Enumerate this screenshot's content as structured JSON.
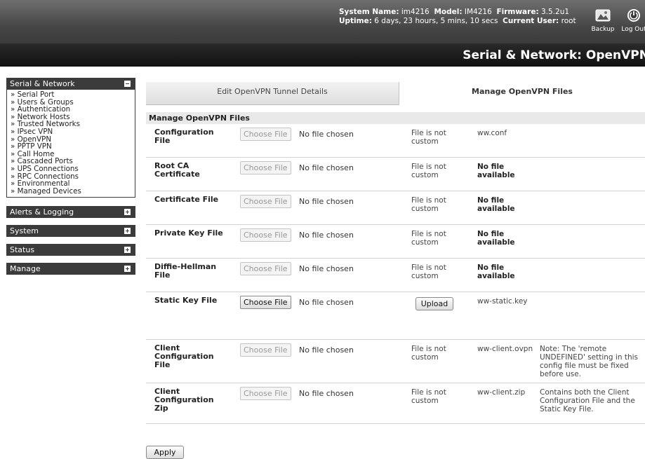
{
  "header": {
    "system_name_label": "System Name:",
    "system_name": "im4216",
    "model_label": "Model:",
    "model": "IM4216",
    "firmware_label": "Firmware:",
    "firmware": "3.5.2u1",
    "uptime_label": "Uptime:",
    "uptime": "6 days, 23 hours, 5 mins, 10 secs",
    "current_user_label": "Current User:",
    "current_user": "root",
    "backup_label": "Backup",
    "logout_label": "Log Out",
    "backup_icon": "backup-icon",
    "logout_icon": "power-icon"
  },
  "page_title": "Serial & Network: OpenVPN",
  "sidebar": {
    "sections": [
      {
        "label": "Serial & Network",
        "expanded": true,
        "items": [
          "» Serial Port",
          "» Users & Groups",
          "» Authentication",
          "» Network Hosts",
          "» Trusted Networks",
          "» IPsec VPN",
          "» OpenVPN",
          "» PPTP VPN",
          "» Call Home",
          "» Cascaded Ports",
          "» UPS Connections",
          "» RPC Connections",
          "» Environmental",
          "» Managed Devices"
        ]
      },
      {
        "label": "Alerts & Logging",
        "expanded": false
      },
      {
        "label": "System",
        "expanded": false
      },
      {
        "label": "Status",
        "expanded": false
      },
      {
        "label": "Manage",
        "expanded": false
      }
    ]
  },
  "tabs": [
    {
      "label": "Edit OpenVPN Tunnel Details",
      "active": false
    },
    {
      "label": "Manage OpenVPN Files",
      "active": true
    }
  ],
  "section_title": "Manage OpenVPN Files",
  "choose_file_label": "Choose File",
  "no_file_chosen": "No file chosen",
  "upload_label": "Upload",
  "apply_label": "Apply",
  "files": [
    {
      "label": "Configuration File",
      "status": "File is not custom",
      "filename": "ww.conf",
      "filename_bold": false,
      "note": ""
    },
    {
      "label": "Root CA Certificate",
      "status": "File is not custom",
      "filename": "No file available",
      "filename_bold": true,
      "note": ""
    },
    {
      "label": "Certificate File",
      "status": "File is not custom",
      "filename": "No file available",
      "filename_bold": true,
      "note": ""
    },
    {
      "label": "Private Key File",
      "status": "File is not custom",
      "filename": "No file available",
      "filename_bold": true,
      "note": ""
    },
    {
      "label": "Diffie-Hellman File",
      "status": "File is not custom",
      "filename": "No file available",
      "filename_bold": true,
      "note": ""
    },
    {
      "label": "Static Key File",
      "status": "",
      "filename": "ww-static.key",
      "filename_bold": false,
      "note": "",
      "upload": true
    },
    {
      "label": "Client Configuration File",
      "status": "File is not custom",
      "filename": "ww-client.ovpn",
      "filename_bold": false,
      "note": "Note: The 'remote UNDEFINED' setting in this config file must be fixed before use."
    },
    {
      "label": "Client Configuration Zip",
      "status": "File is not custom",
      "filename": "ww-client.zip",
      "filename_bold": false,
      "note": "Contains both the Client Configuration File and the Static Key File."
    }
  ]
}
